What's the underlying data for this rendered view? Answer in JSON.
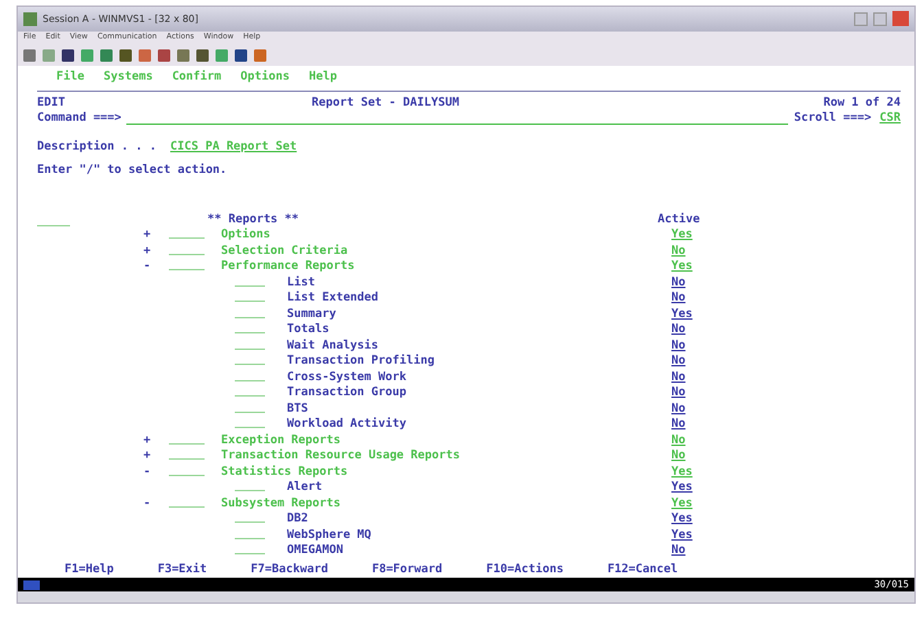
{
  "window": {
    "title": "Session A - WINMVS1 - [32 x 80]"
  },
  "menu": [
    "File",
    "Edit",
    "View",
    "Communication",
    "Actions",
    "Window",
    "Help"
  ],
  "action_bar": [
    "File",
    "Systems",
    "Confirm",
    "Options",
    "Help"
  ],
  "panel": {
    "mode": "EDIT",
    "title": "Report Set - DAILYSUM",
    "row_info": "Row 1 of 24",
    "command_label": "Command ===>",
    "scroll_label": "Scroll ===>",
    "scroll_value": "CSR",
    "description_label": "Description . . .",
    "description_value": "CICS PA Report Set",
    "instruction": "Enter \"/\" to select action.",
    "reports_header": "** Reports **",
    "active_header": "Active"
  },
  "reports": [
    {
      "marker": "+",
      "name": "Options",
      "active": "Yes"
    },
    {
      "marker": "+",
      "name": "Selection Criteria",
      "active": "No"
    },
    {
      "marker": "-",
      "name": "Performance Reports",
      "active": "Yes",
      "children": [
        {
          "name": "List",
          "active": "No"
        },
        {
          "name": "List Extended",
          "active": "No"
        },
        {
          "name": "Summary",
          "active": "Yes"
        },
        {
          "name": "Totals",
          "active": "No"
        },
        {
          "name": "Wait Analysis",
          "active": "No"
        },
        {
          "name": "Transaction Profiling",
          "active": "No"
        },
        {
          "name": "Cross-System Work",
          "active": "No"
        },
        {
          "name": "Transaction Group",
          "active": "No"
        },
        {
          "name": "BTS",
          "active": "No"
        },
        {
          "name": "Workload Activity",
          "active": "No"
        }
      ]
    },
    {
      "marker": "+",
      "name": "Exception Reports",
      "active": "No"
    },
    {
      "marker": "+",
      "name": "Transaction Resource Usage Reports",
      "active": "No"
    },
    {
      "marker": "-",
      "name": "Statistics Reports",
      "active": "Yes",
      "children": [
        {
          "name": "Alert",
          "active": "Yes"
        }
      ]
    },
    {
      "marker": "-",
      "name": "Subsystem Reports",
      "active": "Yes",
      "children": [
        {
          "name": "DB2",
          "active": "Yes"
        },
        {
          "name": "WebSphere MQ",
          "active": "Yes"
        },
        {
          "name": "OMEGAMON",
          "active": "No"
        }
      ]
    }
  ],
  "function_keys": [
    "F1=Help",
    "F3=Exit",
    "F7=Backward",
    "F8=Forward",
    "F10=Actions",
    "F12=Cancel"
  ],
  "oia": {
    "position": "30/015"
  }
}
